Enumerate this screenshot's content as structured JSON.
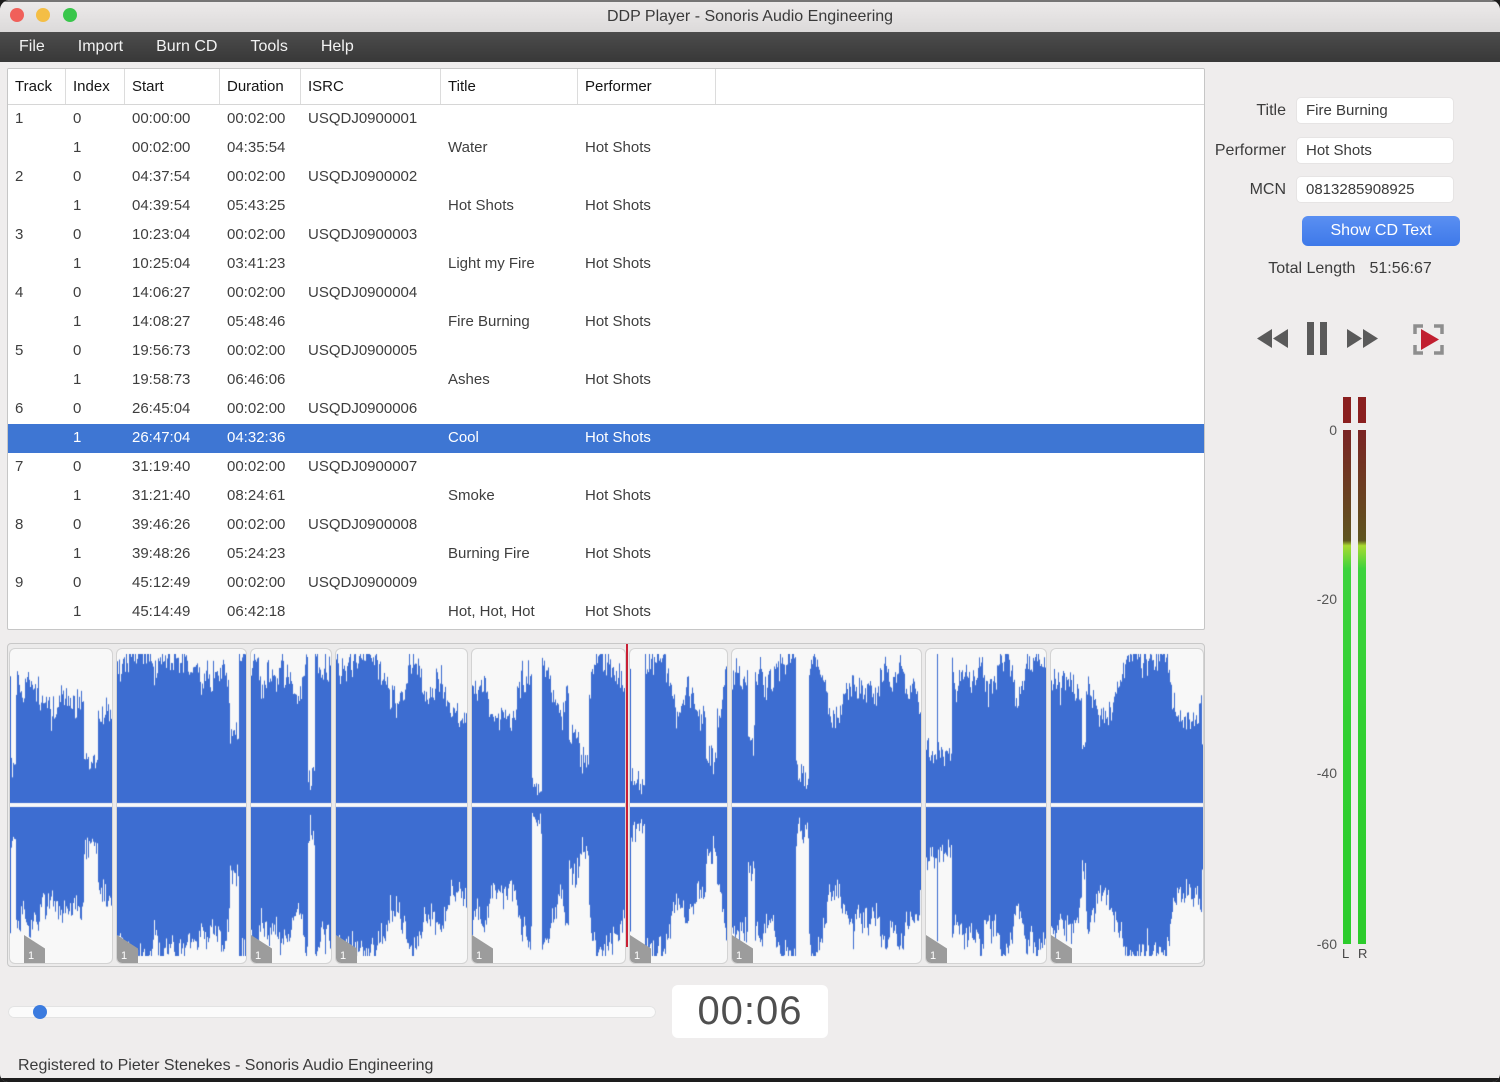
{
  "window": {
    "title": "DDP Player - Sonoris Audio Engineering"
  },
  "menu": {
    "items": [
      "File",
      "Import",
      "Burn CD",
      "Tools",
      "Help"
    ]
  },
  "table": {
    "columns": [
      "Track",
      "Index",
      "Start",
      "Duration",
      "ISRC",
      "Title",
      "Performer"
    ],
    "selected_row": 11,
    "rows": [
      [
        "1",
        "0",
        "00:00:00",
        "00:02:00",
        "USQDJ0900001",
        "",
        ""
      ],
      [
        "",
        "1",
        "00:02:00",
        "04:35:54",
        "",
        "Water",
        "Hot Shots"
      ],
      [
        "2",
        "0",
        "04:37:54",
        "00:02:00",
        "USQDJ0900002",
        "",
        ""
      ],
      [
        "",
        "1",
        "04:39:54",
        "05:43:25",
        "",
        "Hot Shots",
        "Hot Shots"
      ],
      [
        "3",
        "0",
        "10:23:04",
        "00:02:00",
        "USQDJ0900003",
        "",
        ""
      ],
      [
        "",
        "1",
        "10:25:04",
        "03:41:23",
        "",
        "Light my Fire",
        "Hot Shots"
      ],
      [
        "4",
        "0",
        "14:06:27",
        "00:02:00",
        "USQDJ0900004",
        "",
        ""
      ],
      [
        "",
        "1",
        "14:08:27",
        "05:48:46",
        "",
        "Fire Burning",
        "Hot Shots"
      ],
      [
        "5",
        "0",
        "19:56:73",
        "00:02:00",
        "USQDJ0900005",
        "",
        ""
      ],
      [
        "",
        "1",
        "19:58:73",
        "06:46:06",
        "",
        "Ashes",
        "Hot Shots"
      ],
      [
        "6",
        "0",
        "26:45:04",
        "00:02:00",
        "USQDJ0900006",
        "",
        ""
      ],
      [
        "",
        "1",
        "26:47:04",
        "04:32:36",
        "",
        "Cool",
        "Hot Shots"
      ],
      [
        "7",
        "0",
        "31:19:40",
        "00:02:00",
        "USQDJ0900007",
        "",
        ""
      ],
      [
        "",
        "1",
        "31:21:40",
        "08:24:61",
        "",
        "Smoke",
        "Hot Shots"
      ],
      [
        "8",
        "0",
        "39:46:26",
        "00:02:00",
        "USQDJ0900008",
        "",
        ""
      ],
      [
        "",
        "1",
        "39:48:26",
        "05:24:23",
        "",
        "Burning Fire",
        "Hot Shots"
      ],
      [
        "9",
        "0",
        "45:12:49",
        "00:02:00",
        "USQDJ0900009",
        "",
        ""
      ],
      [
        "",
        "1",
        "45:14:49",
        "06:42:18",
        "",
        "Hot, Hot, Hot",
        "Hot Shots"
      ]
    ]
  },
  "cd_text": {
    "title_label": "Title",
    "title_value": "Fire Burning",
    "performer_label": "Performer",
    "performer_value": "Hot Shots",
    "mcn_label": "MCN",
    "mcn_value": "0813285908925",
    "show_button_label": "Show CD Text",
    "total_length_label": "Total Length",
    "total_length_value": "51:56:67"
  },
  "transport": {
    "icons": [
      "rewind-icon",
      "pause-icon",
      "fast-forward-icon",
      "play-to-marker-icon"
    ],
    "time_display": "00:06"
  },
  "meter": {
    "ticks": [
      "0",
      "-20",
      "-40",
      "-60"
    ],
    "channel_left": "L",
    "channel_right": "R"
  },
  "waveform": {
    "marker_label": "1",
    "segment_count": 9
  },
  "statusbar": {
    "text": "Registered to Pieter Stenekes - Sonoris Audio Engineering"
  },
  "colors": {
    "selection": "#3E76D3",
    "waveform_blue": "#3D6DD1",
    "playhead_red": "#C92035",
    "button_blue": "#4583F0",
    "meter_green": "#31D031",
    "meter_peak": "#8A1F1F",
    "traffic_red": "#F0605A",
    "traffic_yellow": "#F4BE45",
    "traffic_green": "#39C64B"
  }
}
